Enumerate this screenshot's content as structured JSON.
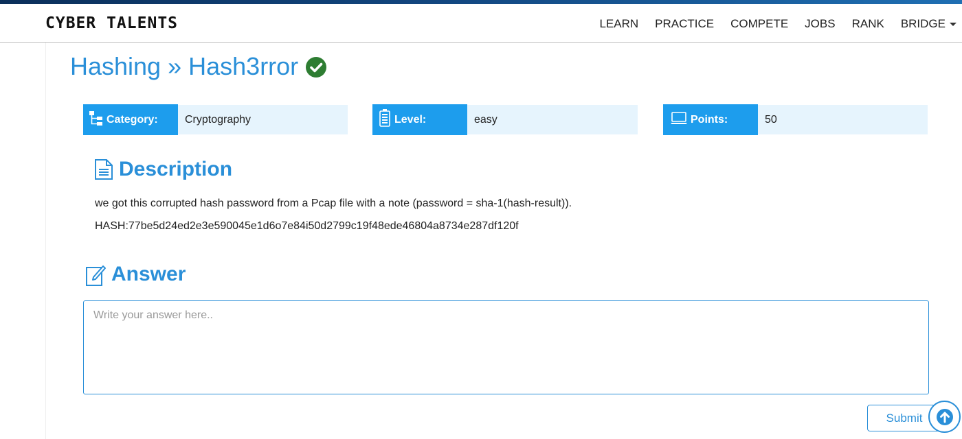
{
  "header": {
    "logo": "CYBER TALENTS",
    "nav": [
      "LEARN",
      "PRACTICE",
      "COMPETE",
      "JOBS",
      "RANK",
      "BRIDGE"
    ]
  },
  "title": {
    "category": "Hashing",
    "separator": "»",
    "challenge": "Hash3rror",
    "status_icon": "check-circle-icon"
  },
  "info": {
    "category_label": "Category:",
    "category_value": "Cryptography",
    "level_label": "Level:",
    "level_value": "easy",
    "points_label": "Points:",
    "points_value": "50"
  },
  "description": {
    "heading": "Description",
    "text": "we got this corrupted hash password from a Pcap file with a note (password = sha-1(hash-result)).",
    "hash": "HASH:77be5d24ed2e3e590045e1d6o7e84i50d2799c19f48ede46804a8734e287df120f"
  },
  "answer": {
    "heading": "Answer",
    "placeholder": "Write your answer here..",
    "value": "",
    "submit_label": "Submit"
  },
  "colors": {
    "accent": "#2a8fd8",
    "label_bg": "#1d9ded",
    "value_bg": "#e6f4fd",
    "success": "#2e7d32"
  }
}
